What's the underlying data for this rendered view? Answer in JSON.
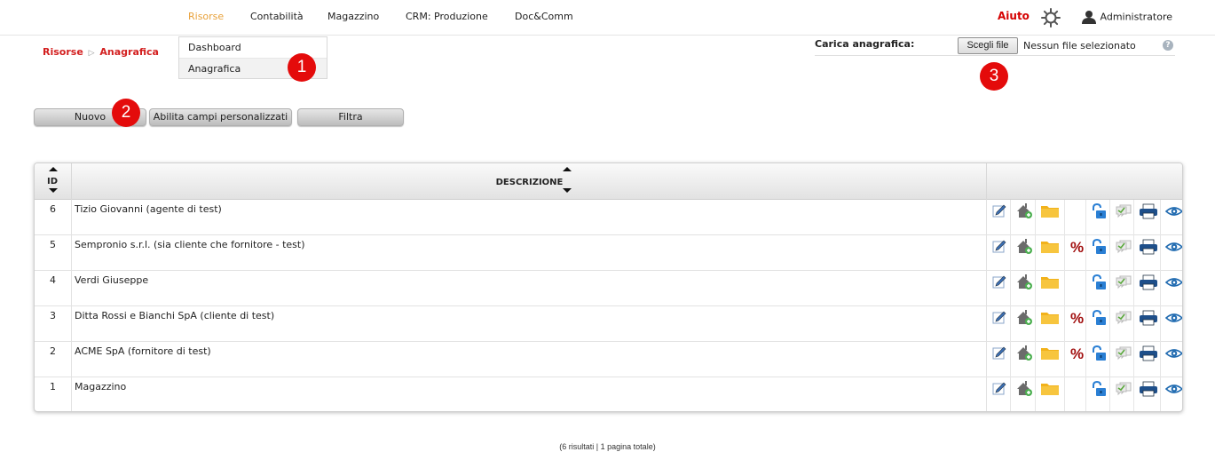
{
  "nav": {
    "items": [
      "Risorse",
      "Contabilità",
      "Magazzino",
      "CRM: Produzione",
      "Doc&Comm"
    ],
    "active": "Risorse",
    "help_label": "Aiuto",
    "user_name": "Administratore"
  },
  "breadcrumb": {
    "section": "Risorse",
    "separator": "▷",
    "page": "Anagrafica"
  },
  "dropdown": {
    "items": [
      "Dashboard",
      "Anagrafica"
    ]
  },
  "callouts": [
    "1",
    "2",
    "3"
  ],
  "upload": {
    "label": "Carica anagrafica:",
    "button_label": "Scegli file",
    "status": "Nessun file selezionato",
    "help_glyph": "?"
  },
  "actions": {
    "new_label": "Nuovo",
    "custom_fields_label": "Abilita campi personalizzati",
    "filter_label": "Filtra"
  },
  "table": {
    "headers": {
      "id": "ID",
      "description": "DESCRIZIONE"
    },
    "rows": [
      {
        "id": "6",
        "description": "Tizio Giovanni (agente di test)",
        "discount": false
      },
      {
        "id": "5",
        "description": "Sempronio s.r.l. (sia cliente che fornitore - test)",
        "discount": true
      },
      {
        "id": "4",
        "description": "Verdi Giuseppe",
        "discount": false
      },
      {
        "id": "3",
        "description": "Ditta Rossi e Bianchi SpA (cliente di test)",
        "discount": true
      },
      {
        "id": "2",
        "description": "ACME SpA (fornitore di test)",
        "discount": true
      },
      {
        "id": "1",
        "description": "Magazzino",
        "discount": false
      }
    ]
  },
  "footer": "(6 risultati | 1 pagina totale)",
  "colors": {
    "active_nav": "#e8a13a",
    "brand_red": "#d32020",
    "callout": "#e40b0b"
  }
}
